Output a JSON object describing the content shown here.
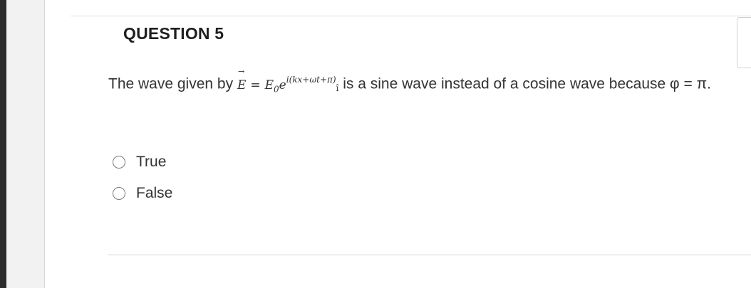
{
  "question": {
    "title": "QUESTION 5",
    "text_before": "The wave given by ",
    "formula": {
      "vector_symbol": "E",
      "arrow": "→",
      "equals": "=",
      "amplitude": "E",
      "amplitude_subscript": "0",
      "base": "e",
      "exponent": "i(kx+ωt+π)",
      "trailing": "î"
    },
    "text_after": " is a sine wave instead of a cosine wave because φ = π."
  },
  "options": [
    {
      "label": "True",
      "selected": false
    },
    {
      "label": "False",
      "selected": false
    }
  ]
}
